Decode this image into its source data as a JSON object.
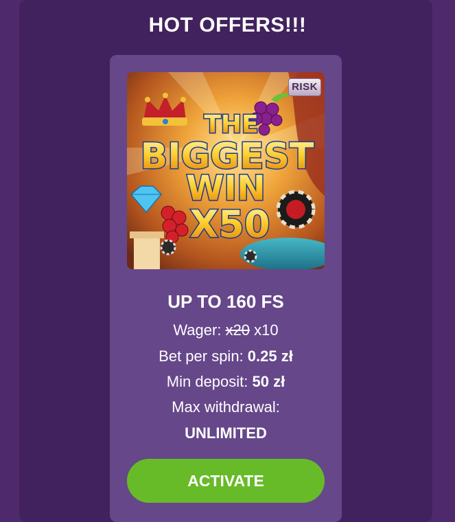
{
  "page": {
    "heading": "HOT OFFERS!!!"
  },
  "offer": {
    "image": {
      "badge": "RISK",
      "line1": "THE",
      "line2": "BIGGEST",
      "line3": "WIN",
      "line4": "X50"
    },
    "title": "UP TO 160 FS",
    "wager": {
      "label": "Wager:",
      "old_value": "x20",
      "new_value": "x10"
    },
    "bet_per_spin": {
      "label": "Bet per spin:",
      "value": "0.25 zł"
    },
    "min_deposit": {
      "label": "Min deposit:",
      "value": "50 zł"
    },
    "max_withdrawal": {
      "label": "Max withdrawal:",
      "value": "UNLIMITED"
    },
    "button_label": "ACTIVATE"
  },
  "colors": {
    "background": "#4e2a6c",
    "panel": "#42225e",
    "card": "#66478a",
    "button": "#67bb28",
    "text": "#ffffff"
  }
}
